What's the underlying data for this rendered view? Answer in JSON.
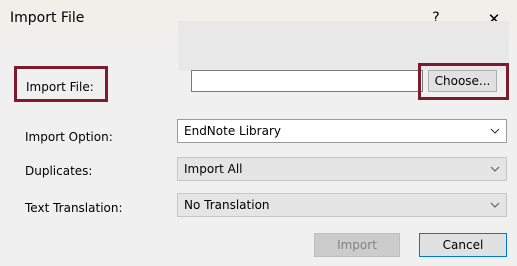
{
  "dialog": {
    "title": "Import File",
    "help_glyph": "?",
    "close_glyph": "✕"
  },
  "fields": {
    "import_file": {
      "label": "Import File:",
      "value": "",
      "choose_label": "Choose..."
    },
    "import_option": {
      "label": "Import Option:",
      "selected": "EndNote Library"
    },
    "duplicates": {
      "label": "Duplicates:",
      "selected": "Import All"
    },
    "text_translation": {
      "label": "Text Translation:",
      "selected": "No Translation"
    }
  },
  "buttons": {
    "import": {
      "label": "Import",
      "enabled": false
    },
    "cancel": {
      "label": "Cancel"
    }
  },
  "colors": {
    "highlight": "#7d1a2b",
    "focus": "#0078d7"
  },
  "icons": {
    "dropdown": "chevron-down-icon",
    "help": "help-icon",
    "close": "close-icon"
  }
}
